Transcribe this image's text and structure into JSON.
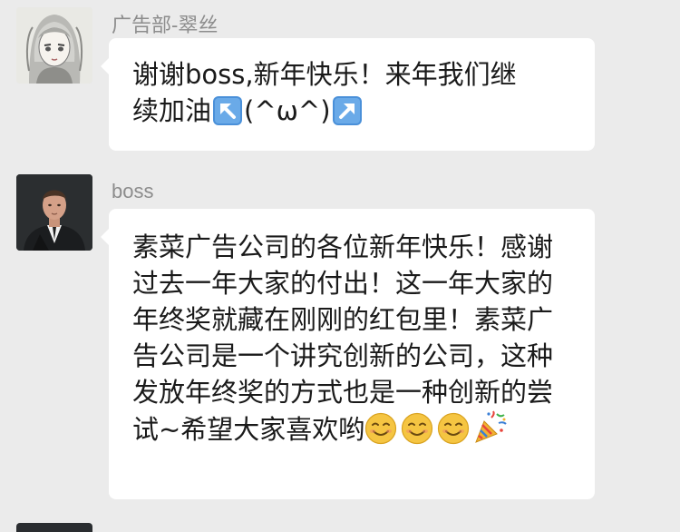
{
  "messages": [
    {
      "sender": "广告部-翠丝",
      "lines": [
        [
          "谢谢boss,新年快乐！来年我们继"
        ],
        [
          "续加油",
          "up-left-arrow-emoji",
          "(^ω^)",
          "up-right-arrow-emoji"
        ]
      ]
    },
    {
      "sender": "boss",
      "lines": [
        [
          "素菜广告公司的各位新年快乐！感谢"
        ],
        [
          "过去一年大家的付出！这一年大家的"
        ],
        [
          "年终奖就藏在刚刚的红包里！素菜广"
        ],
        [
          "告公司是一个讲究创新的公司，这种"
        ],
        [
          "发放年终奖的方式也是一种创新的尝"
        ],
        [
          "试~希望大家喜欢哟",
          "smile-emoji",
          "smile-emoji",
          "smile-emoji",
          "party-popper-emoji"
        ]
      ]
    }
  ],
  "colors": {
    "background": "#ebebeb",
    "bubble": "#ffffff",
    "sender_name": "#8c8c8c",
    "message_text": "#1a1a1a",
    "arrow_emoji": "#4a90d9",
    "smile_emoji": "#f5c542"
  }
}
